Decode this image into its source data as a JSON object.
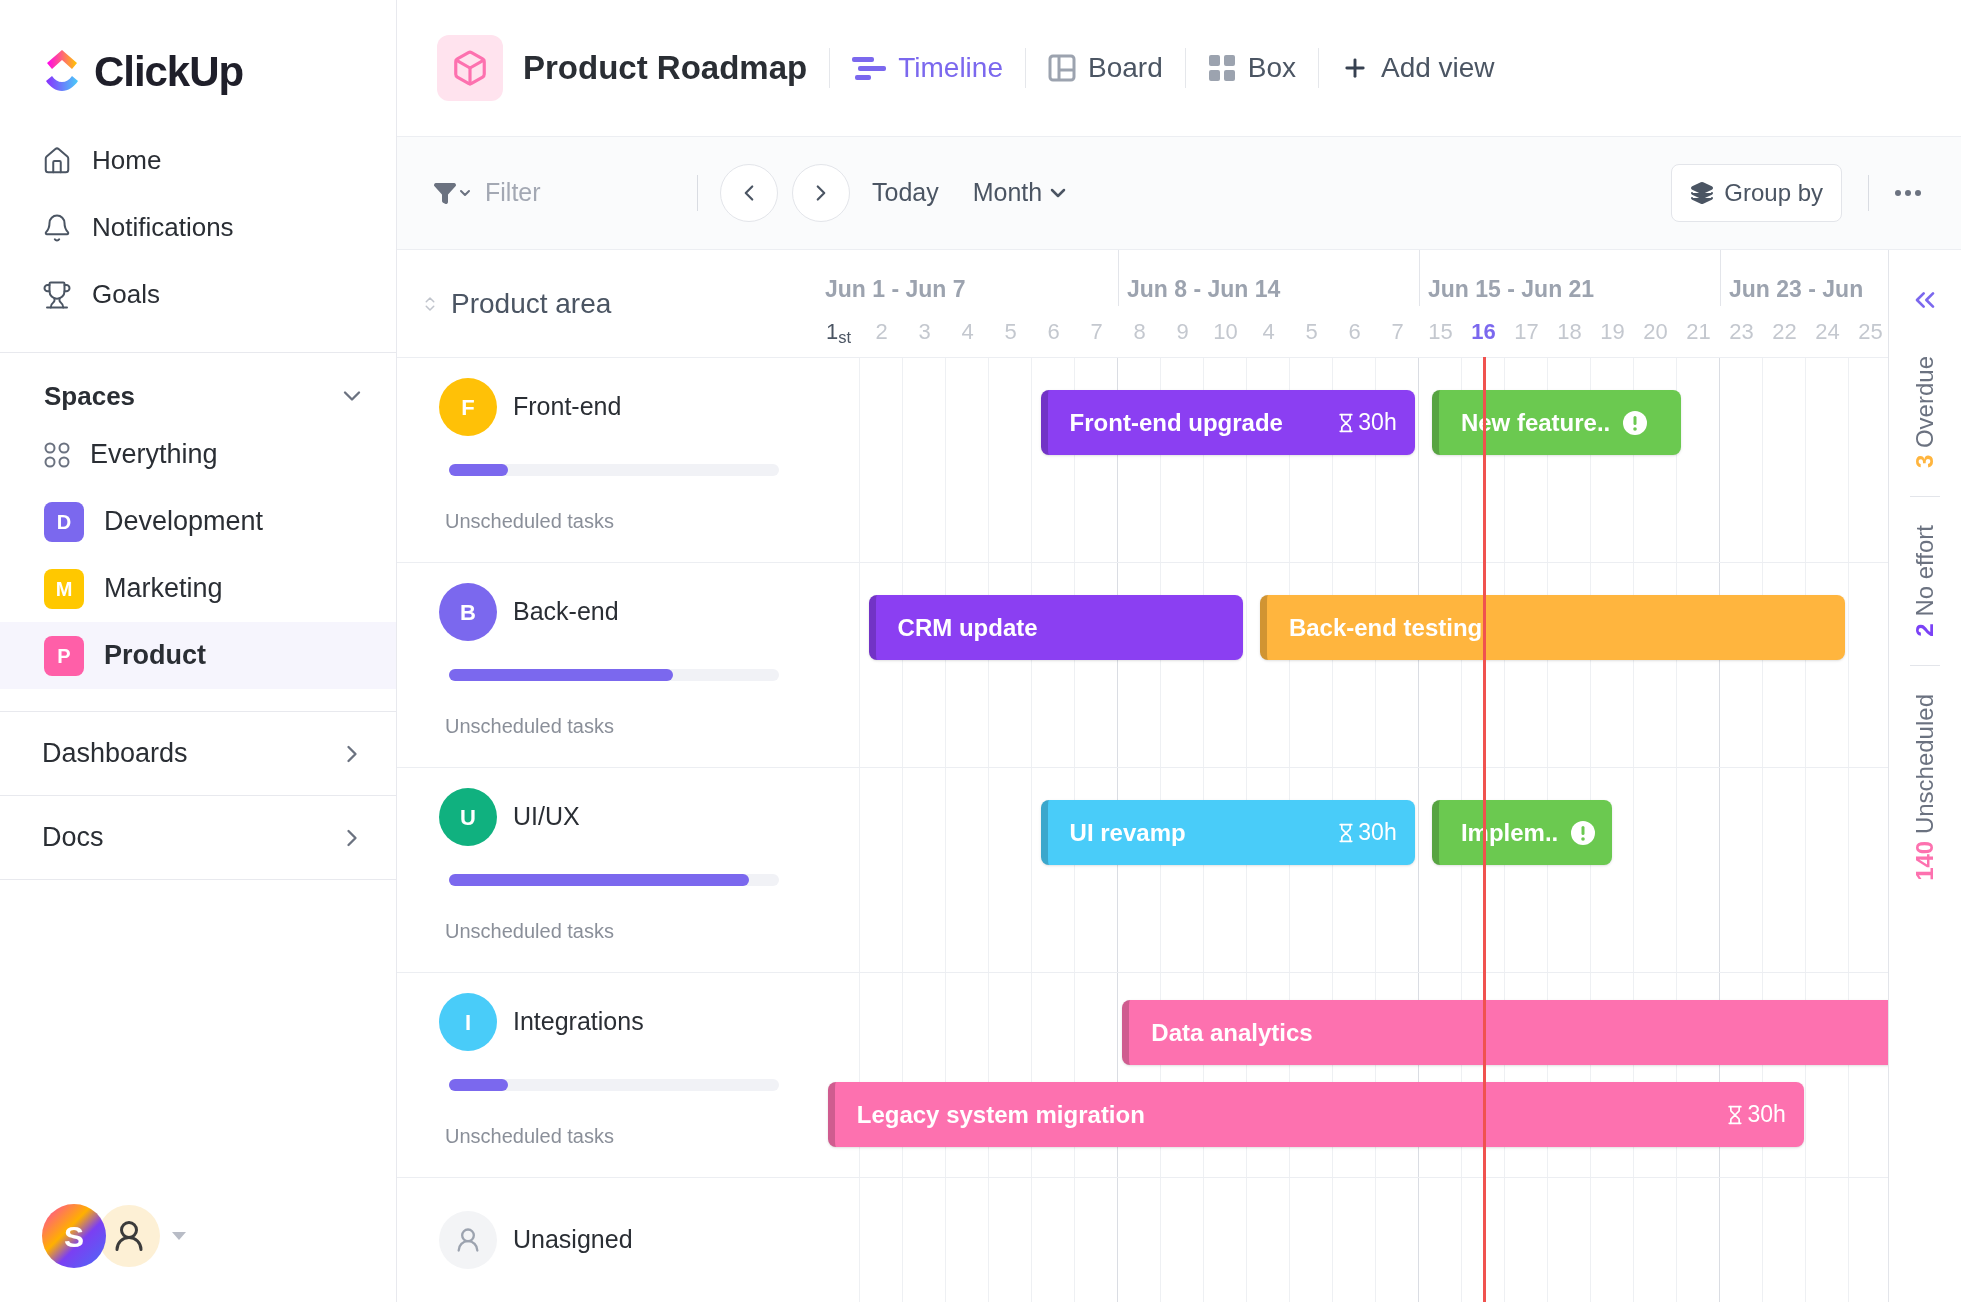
{
  "sidebar": {
    "logo": "ClickUp",
    "nav": [
      {
        "kind": "home",
        "label": "Home"
      },
      {
        "kind": "bell",
        "label": "Notifications"
      },
      {
        "kind": "trophy",
        "label": "Goals"
      }
    ],
    "spaces": {
      "title": "Spaces",
      "expanded": true,
      "items": [
        {
          "kind": "all",
          "label": "Everything",
          "selected": false
        },
        {
          "kind": "space",
          "initial": "D",
          "label": "Development",
          "color": "#7b68ee",
          "selected": false
        },
        {
          "kind": "space",
          "initial": "M",
          "label": "Marketing",
          "color": "#ffc800",
          "selected": false
        },
        {
          "kind": "space",
          "initial": "P",
          "label": "Product",
          "color": "#ff5fa8",
          "selected": true
        }
      ]
    },
    "sections": [
      {
        "label": "Dashboards",
        "expanded": false
      },
      {
        "label": "Docs",
        "expanded": false
      }
    ],
    "user": {
      "initial": "S"
    }
  },
  "header": {
    "title": "Product Roadmap",
    "views": [
      {
        "kind": "timeline",
        "label": "Timeline",
        "selected": true
      },
      {
        "kind": "board",
        "label": "Board",
        "selected": false
      },
      {
        "kind": "box",
        "label": "Box",
        "selected": false
      }
    ],
    "add_view": "Add view"
  },
  "toolbar": {
    "filter_placeholder": "Filter",
    "today": "Today",
    "period": "Month",
    "group_by": "Group by"
  },
  "timeline": {
    "column_header": "Product area",
    "weeks": [
      "Jun 1 - Jun 7",
      "Jun 8 - Jun 14",
      "Jun 15 - Jun 21",
      "Jun 23 - Jun"
    ],
    "days": [
      {
        "label": "1$_{st}$",
        "selected": false
      },
      {
        "label": "2",
        "selected": false
      },
      {
        "label": "3",
        "selected": false
      },
      {
        "label": "4",
        "selected": false
      },
      {
        "label": "5",
        "selected": false
      },
      {
        "label": "6",
        "selected": false
      },
      {
        "label": "7",
        "selected": false
      },
      {
        "label": "8",
        "selected": false
      },
      {
        "label": "9",
        "selected": false
      },
      {
        "label": "10",
        "selected": false
      },
      {
        "label": "4",
        "selected": false
      },
      {
        "label": "5",
        "selected": false
      },
      {
        "label": "6",
        "selected": false
      },
      {
        "label": "7",
        "selected": false
      },
      {
        "label": "15",
        "selected": false
      },
      {
        "label": "16",
        "selected": true
      },
      {
        "label": "17",
        "selected": false
      },
      {
        "label": "18",
        "selected": false
      },
      {
        "label": "19",
        "selected": false
      },
      {
        "label": "20",
        "selected": false
      },
      {
        "label": "21",
        "selected": false
      },
      {
        "label": "23",
        "selected": false
      },
      {
        "label": "22",
        "selected": false
      },
      {
        "label": "24",
        "selected": false
      },
      {
        "label": "25",
        "selected": false
      }
    ],
    "groups": [
      {
        "initial": "F",
        "name": "Front-end",
        "color": "#ffc107",
        "level": 0.18,
        "footer": "Unscheduled tasks",
        "tasks": [
          {
            "title": "Front-end upgrade",
            "color": "#8b3ff2",
            "effort": "30h",
            "alert": false
          },
          {
            "title": "New feature..",
            "color": "#6bc950",
            "alert": true
          }
        ]
      },
      {
        "initial": "B",
        "name": "Back-end",
        "color": "#7b68ee",
        "level": 0.68,
        "footer": "Unscheduled tasks",
        "tasks": [
          {
            "title": "CRM update",
            "color": "#8b3ff2",
            "alert": false
          },
          {
            "title": "Back-end testing",
            "color": "#ffb53e",
            "alert": false
          }
        ]
      },
      {
        "initial": "U",
        "name": "UI/UX",
        "color": "#10b17f",
        "level": 0.91,
        "footer": "Unscheduled tasks",
        "tasks": [
          {
            "title": "UI revamp",
            "color": "#49ccf9",
            "effort": "30h",
            "alert": false
          },
          {
            "title": "Implem..",
            "color": "#6bc950",
            "alert": true
          }
        ]
      },
      {
        "initial": "I",
        "name": "Integrations",
        "color": "#49ccf9",
        "level": 0.18,
        "footer": "Unscheduled tasks",
        "tasks": [
          {
            "title": "Data analytics",
            "color": "#fd71af",
            "alert": false
          },
          {
            "title": "Legacy system migration",
            "color": "#fd71af",
            "effort": "30h",
            "alert": false
          }
        ]
      }
    ],
    "unassigned": "Unasigned"
  },
  "summary": [
    {
      "count": "3",
      "label": "Overdue",
      "color": "#ffb53e"
    },
    {
      "count": "2",
      "label": "No effort",
      "color": "#7b42f6"
    },
    {
      "count": "140",
      "label": "Unscheduled",
      "color": "#fd71af"
    }
  ]
}
